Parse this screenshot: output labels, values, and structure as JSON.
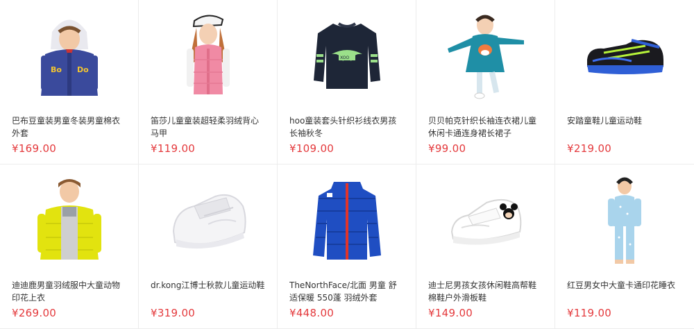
{
  "products": [
    {
      "name": "巴布豆童装男童冬装男童棉衣外套",
      "price": "¥169.00",
      "image": "boy-hooded-jacket-photo"
    },
    {
      "name": "笛莎儿童童装超轻柔羽绒背心马甲",
      "price": "¥119.00",
      "image": "girl-pink-vest-photo"
    },
    {
      "name": "hoo童装套头针织衫线衣男孩长袖秋冬",
      "price": "¥109.00",
      "image": "navy-sweater-photo"
    },
    {
      "name": "贝贝帕克针织长袖连衣裙儿童休闲卡通连身裙长裙子",
      "price": "¥99.00",
      "image": "girl-teal-dress-photo"
    },
    {
      "name": "安踏童鞋儿童运动鞋",
      "price": "¥219.00",
      "image": "blue-sneaker-photo"
    },
    {
      "name": "迪迪鹿男童羽绒服中大童动物印花上衣",
      "price": "¥269.00",
      "image": "boy-yellow-down-jacket-photo"
    },
    {
      "name": "dr.kong江博士秋款儿童运动鞋",
      "price": "¥319.00",
      "image": "white-sneaker-photo"
    },
    {
      "name": "TheNorthFace/北面 男童 舒适保暖 550蓬 羽绒外套",
      "price": "¥448.00",
      "image": "blue-puffer-jacket-photo"
    },
    {
      "name": "迪士尼男孩女孩休闲鞋高帮鞋棉鞋户外滑板鞋",
      "price": "¥149.00",
      "image": "white-mickey-shoe-photo"
    },
    {
      "name": "红豆男女中大童卡通印花睡衣",
      "price": "¥119.00",
      "image": "kid-blue-pajamas-photo"
    }
  ],
  "colors": {
    "price": "#e4393c",
    "title": "#333333",
    "divider": "#ececec"
  }
}
